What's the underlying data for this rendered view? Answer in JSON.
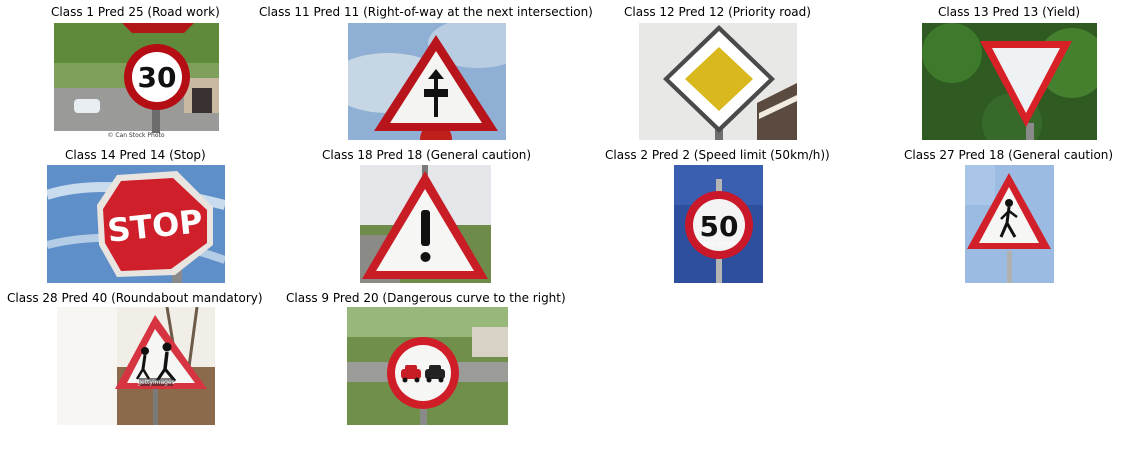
{
  "figure": {
    "panels": [
      {
        "title": "Class 1 Pred 25 (Road work)",
        "image": "speed-limit-30-sign-photo",
        "watermark": "© Can Stock Photo"
      },
      {
        "title": "Class 11 Pred 11 (Right-of-way at the next intersection)",
        "image": "right-of-way-sign-photo"
      },
      {
        "title": "Class 12 Pred 12 (Priority road)",
        "image": "priority-road-sign-photo"
      },
      {
        "title": "Class 13 Pred 13 (Yield)",
        "image": "yield-sign-photo"
      },
      {
        "title": "Class 14 Pred 14 (Stop)",
        "image": "stop-sign-photo",
        "sign_text": "STOP"
      },
      {
        "title": "Class 18 Pred 18 (General caution)",
        "image": "general-caution-sign-photo"
      },
      {
        "title": "Class 2 Pred 2 (Speed limit (50km/h))",
        "image": "speed-limit-50-sign-photo",
        "sign_text": "50"
      },
      {
        "title": "Class 27 Pred 18 (General caution)",
        "image": "pedestrians-sign-photo"
      },
      {
        "title": "Class 28 Pred 40 (Roundabout mandatory)",
        "image": "children-crossing-sign-photo",
        "watermark": "gettyimages"
      },
      {
        "title": "Class 9 Pred 20 (Dangerous curve to the right)",
        "image": "no-passing-sign-photo"
      }
    ],
    "first_sign_text": "30",
    "getty_small": "getty images"
  }
}
